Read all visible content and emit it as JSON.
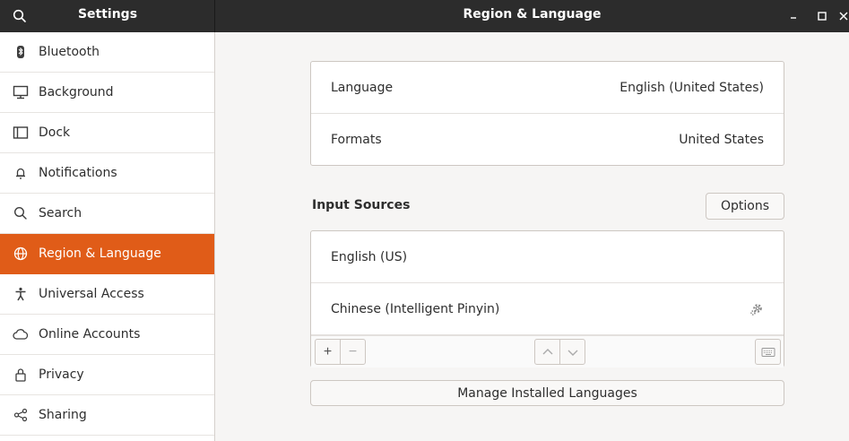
{
  "window": {
    "sidebar_title": "Settings",
    "title": "Region & Language",
    "search_icon": "search-icon",
    "controls": [
      "minimize-icon",
      "maximize-icon",
      "close-icon"
    ]
  },
  "sidebar": {
    "items": [
      {
        "label": "Bluetooth",
        "icon": "bluetooth-icon",
        "active": false
      },
      {
        "label": "Background",
        "icon": "background-icon",
        "active": false
      },
      {
        "label": "Dock",
        "icon": "dock-icon",
        "active": false
      },
      {
        "label": "Notifications",
        "icon": "bell-icon",
        "active": false
      },
      {
        "label": "Search",
        "icon": "search-icon",
        "active": false
      },
      {
        "label": "Region & Language",
        "icon": "globe-icon",
        "active": true
      },
      {
        "label": "Universal Access",
        "icon": "accessibility-icon",
        "active": false
      },
      {
        "label": "Online Accounts",
        "icon": "cloud-icon",
        "active": false
      },
      {
        "label": "Privacy",
        "icon": "lock-icon",
        "active": false
      },
      {
        "label": "Sharing",
        "icon": "share-icon",
        "active": false
      }
    ]
  },
  "language": {
    "label": "Language",
    "value": "English (United States)"
  },
  "formats": {
    "label": "Formats",
    "value": "United States"
  },
  "input_sources": {
    "title": "Input Sources",
    "options_label": "Options",
    "sources": [
      {
        "label": "English (US)",
        "has_settings": false
      },
      {
        "label": "Chinese (Intelligent Pinyin)",
        "has_settings": true
      }
    ],
    "toolbar": {
      "add_label": "+",
      "remove_label": "−"
    }
  },
  "manage_languages_label": "Manage Installed Languages",
  "colors": {
    "accent": "#e05c18",
    "headerbar": "#2c2c2c",
    "background": "#f6f5f4"
  }
}
